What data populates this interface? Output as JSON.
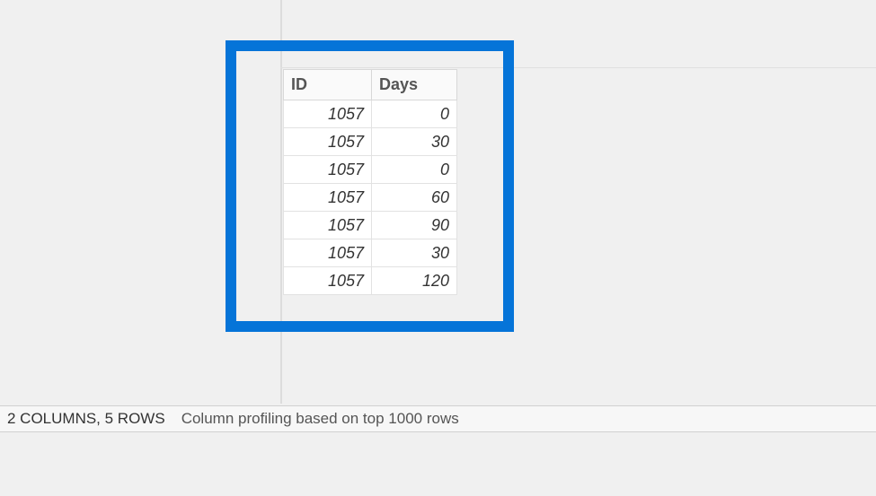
{
  "chart_data": {
    "type": "table",
    "columns": [
      "ID",
      "Days"
    ],
    "rows": [
      [
        1057,
        0
      ],
      [
        1057,
        30
      ],
      [
        1057,
        0
      ],
      [
        1057,
        60
      ],
      [
        1057,
        90
      ],
      [
        1057,
        30
      ],
      [
        1057,
        120
      ]
    ]
  },
  "table": {
    "header_id": "ID",
    "header_days": "Days",
    "rows": [
      {
        "id": "1057",
        "days": "0"
      },
      {
        "id": "1057",
        "days": "30"
      },
      {
        "id": "1057",
        "days": "0"
      },
      {
        "id": "1057",
        "days": "60"
      },
      {
        "id": "1057",
        "days": "90"
      },
      {
        "id": "1057",
        "days": "30"
      },
      {
        "id": "1057",
        "days": "120"
      }
    ]
  },
  "status": {
    "columns_rows": "2 COLUMNS, 5 ROWS",
    "profiling": "Column profiling based on top 1000 rows"
  }
}
